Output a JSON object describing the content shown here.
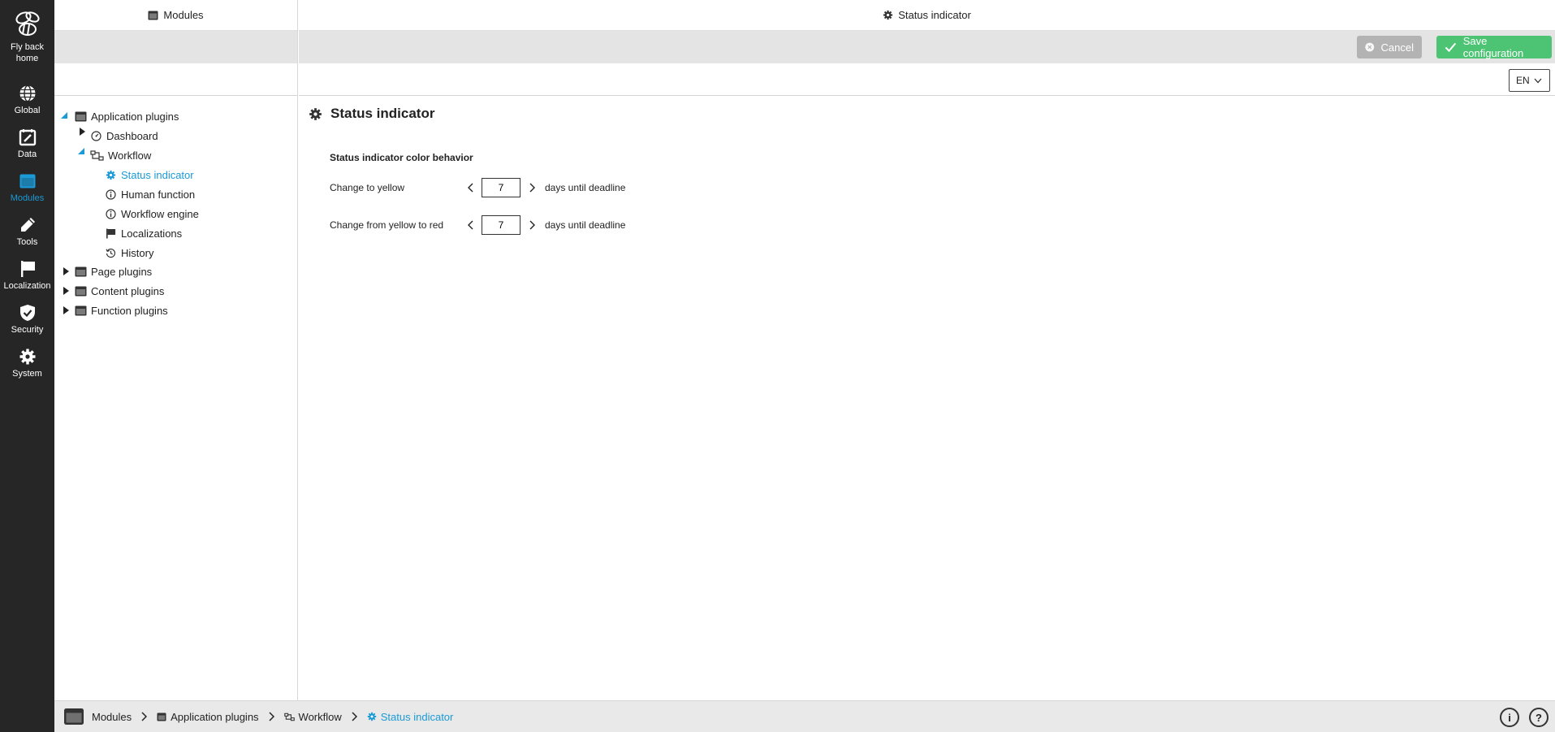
{
  "nav": {
    "home": "Fly back home",
    "items": [
      {
        "label": "Global",
        "icon": "globe-icon"
      },
      {
        "label": "Data",
        "icon": "calendar-edit-icon"
      },
      {
        "label": "Modules",
        "icon": "module-window-icon"
      },
      {
        "label": "Tools",
        "icon": "pencil-icon"
      },
      {
        "label": "Localization",
        "icon": "flag-icon"
      },
      {
        "label": "Security",
        "icon": "shield-check-icon"
      },
      {
        "label": "System",
        "icon": "gear-icon"
      }
    ],
    "active": "Modules"
  },
  "tree_panel": {
    "title": "Modules",
    "items": [
      {
        "label": "Application plugins"
      },
      {
        "label": "Dashboard"
      },
      {
        "label": "Workflow"
      },
      {
        "label": "Status indicator"
      },
      {
        "label": "Human function"
      },
      {
        "label": "Workflow engine"
      },
      {
        "label": "Localizations"
      },
      {
        "label": "History"
      },
      {
        "label": "Page plugins"
      },
      {
        "label": "Content plugins"
      },
      {
        "label": "Function plugins"
      }
    ]
  },
  "main": {
    "header_title": "Status indicator",
    "cancel_label": "Cancel",
    "save_label": "Save configuration",
    "language": "EN",
    "page_title": "Status indicator",
    "section_title": "Status indicator color behavior",
    "rows": [
      {
        "label": "Change to yellow",
        "value": "7",
        "suffix": "days until deadline"
      },
      {
        "label": "Change from yellow to red",
        "value": "7",
        "suffix": "days until deadline"
      }
    ]
  },
  "footer": {
    "breadcrumbs": [
      "Modules",
      "Application plugins",
      "Workflow",
      "Status indicator"
    ],
    "info_symbol": "i",
    "help_symbol": "?"
  },
  "colors": {
    "accent": "#1a9ad6",
    "save": "#4cc474",
    "cancel": "#b3b3b3",
    "nav_bg": "#262626"
  }
}
